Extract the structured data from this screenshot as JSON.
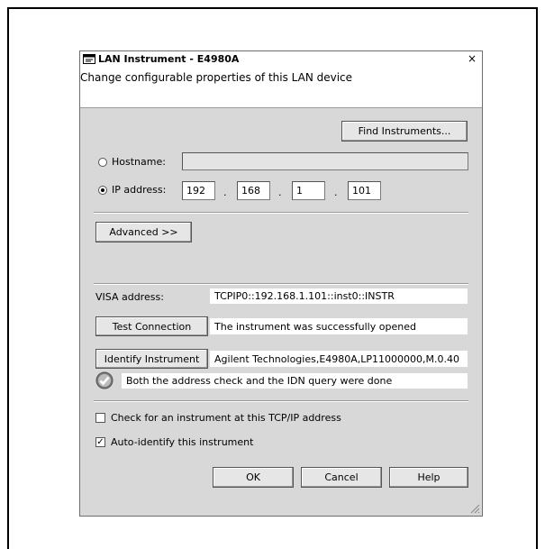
{
  "dialog": {
    "title": "LAN Instrument - E4980A",
    "subtitle": "Change configurable properties of this LAN device",
    "close_symbol": "×"
  },
  "find_button": "Find Instruments...",
  "hostname": {
    "label": "Hostname:",
    "value": ""
  },
  "ip": {
    "label": "IP address:",
    "octets": [
      "192",
      "168",
      "1",
      "101"
    ],
    "separator": "."
  },
  "advanced_button": "Advanced >>",
  "visa": {
    "label": "VISA address:",
    "value": "TCPIP0::192.168.1.101::inst0::INSTR"
  },
  "test": {
    "button": "Test Connection",
    "result": "The instrument was successfully opened"
  },
  "identify": {
    "button": "Identify Instrument",
    "result": "Agilent Technologies,E4980A,LP11000000,M.0.40"
  },
  "status": {
    "icon": "success-check-icon",
    "text": "Both the address check and the IDN query were done"
  },
  "options": {
    "check_address": {
      "label": "Check for an instrument at this TCP/IP address",
      "checked": false
    },
    "auto_identify": {
      "label": "Auto-identify this instrument",
      "checked": true
    }
  },
  "buttons": {
    "ok": "OK",
    "cancel": "Cancel",
    "help": "Help"
  },
  "selected_mode": "ip-address"
}
